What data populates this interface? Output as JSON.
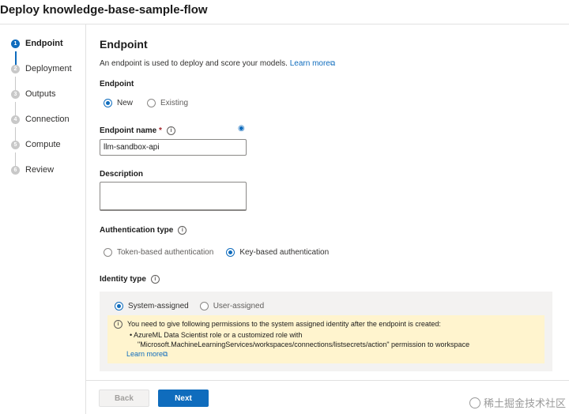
{
  "window": {
    "title": "Deploy knowledge-base-sample-flow"
  },
  "steps": [
    {
      "number": "1",
      "label": "Endpoint",
      "active": true
    },
    {
      "number": "2",
      "label": "Deployment",
      "active": false
    },
    {
      "number": "3",
      "label": "Outputs",
      "active": false
    },
    {
      "number": "4",
      "label": "Connection",
      "active": false
    },
    {
      "number": "5",
      "label": "Compute",
      "active": false
    },
    {
      "number": "6",
      "label": "Review",
      "active": false
    }
  ],
  "main": {
    "heading": "Endpoint",
    "description": "An endpoint is used to deploy and score your models.",
    "learn_more": "Learn more",
    "endpoint_section_label": "Endpoint",
    "endpoint_options": {
      "new": "New",
      "existing": "Existing",
      "selected": "New"
    },
    "endpoint_name_label": "Endpoint name",
    "required_mark": "*",
    "endpoint_name_value": "llm-sandbox-api",
    "description_label": "Description",
    "description_value": "",
    "auth_label": "Authentication type",
    "auth_options": {
      "token": "Token-based authentication",
      "key": "Key-based authentication",
      "selected": "Key-based authentication"
    },
    "identity_label": "Identity type",
    "identity_options": {
      "system": "System-assigned",
      "user": "User-assigned",
      "selected": "System-assigned"
    },
    "warning": {
      "text": "You need to give following permissions to the system assigned identity after the endpoint is created:",
      "bullet": "AzureML Data Scientist role or a customized role with",
      "bullet_cont": "\"Microsoft.MachineLearningServices/workspaces/connections/listsecrets/action\" permission to workspace",
      "learn_more": "Learn more"
    }
  },
  "footer": {
    "back_label": "Back",
    "next_label": "Next"
  },
  "watermark": {
    "text": "稀土掘金技术社区"
  },
  "colors": {
    "accent": "#0f6cbd",
    "warning_bg": "#fff4ce",
    "panel_bg": "#f3f2f1"
  }
}
